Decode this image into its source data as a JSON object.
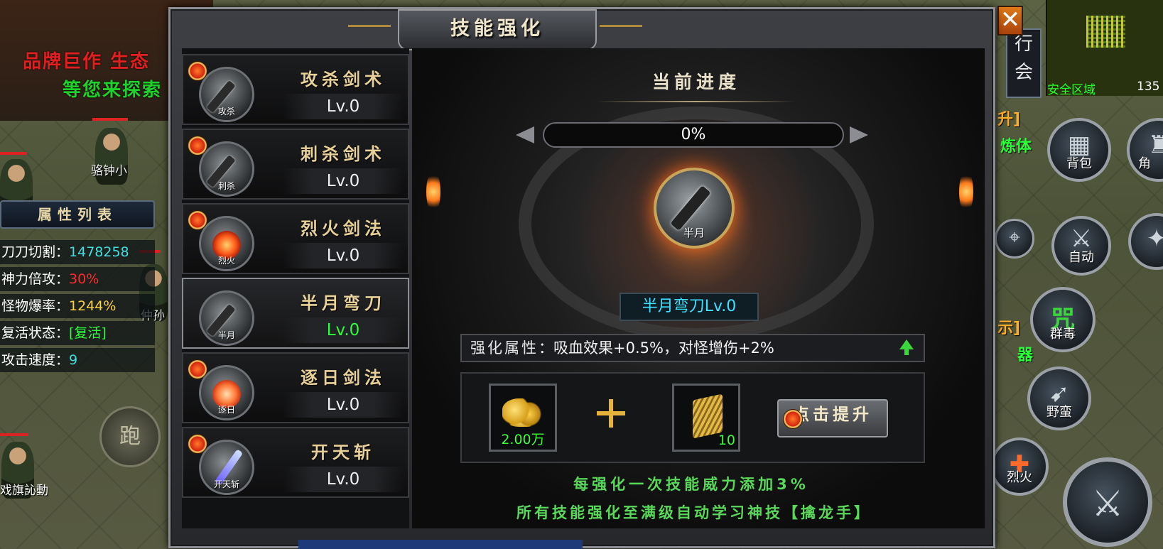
{
  "background": {
    "promo_line1": "品牌巨作  生态",
    "promo_line2": "等您来探索",
    "npc_names": [
      "骆钟小",
      "仲孙",
      "戏旗訫動"
    ],
    "run_button": "跑",
    "attributes": {
      "title": "属性列表",
      "rows": [
        {
          "label": "刀刀切割：",
          "value": "1478258",
          "color": "cyan"
        },
        {
          "label": "神力倍攻：",
          "value": "30%",
          "color": "red"
        },
        {
          "label": "怪物爆率：",
          "value": "1244%",
          "color": "yellow"
        },
        {
          "label": "复活状态：",
          "value": "[复活]",
          "color": "green"
        },
        {
          "label": "攻击速度：",
          "value": "9",
          "color": "cyan"
        }
      ]
    },
    "minimap": {
      "zone": "安全区域",
      "coord": "135"
    },
    "guild_button": [
      "行",
      "会"
    ],
    "side_labels": [
      "升]",
      "炼体",
      "示]",
      "器"
    ],
    "hud_buttons": [
      {
        "label": "背包",
        "icon": "bag-icon"
      },
      {
        "label": "角",
        "icon": "armor-icon"
      },
      {
        "label": "自动",
        "icon": "crossed-swords-icon"
      },
      {
        "label": "群毒",
        "glyph": "咒"
      },
      {
        "label": "野蛮",
        "icon": "charge-icon"
      },
      {
        "label": "烈火",
        "icon": "fire-sword-icon"
      }
    ]
  },
  "panel": {
    "title": "技能强化",
    "close_label": "✕",
    "skills": [
      {
        "name": "攻杀剑术",
        "level": "Lv.0",
        "icon_label": "攻杀",
        "icon_type": "blade"
      },
      {
        "name": "刺杀剑术",
        "level": "Lv.0",
        "icon_label": "刺杀",
        "icon_type": "blade"
      },
      {
        "name": "烈火剑法",
        "level": "Lv.0",
        "icon_label": "烈火",
        "icon_type": "fire"
      },
      {
        "name": "半月弯刀",
        "level": "Lv.0",
        "icon_label": "半月",
        "icon_type": "blade",
        "selected": true
      },
      {
        "name": "逐日剑法",
        "level": "Lv.0",
        "icon_label": "逐日",
        "icon_type": "fire"
      },
      {
        "name": "开天斩",
        "level": "Lv.0",
        "icon_label": "开天斩",
        "icon_type": "beam"
      }
    ],
    "progress": {
      "title": "当前进度",
      "percent_text": "0%",
      "value": 0
    },
    "selected_skill": {
      "icon_label": "半月",
      "title": "半月弯刀Lv.0"
    },
    "enhance": {
      "label": "强化属性",
      "value": "：吸血效果+0.5%，对怪增伤+2%"
    },
    "costs": [
      {
        "item": "gold-coins",
        "qty": "2.00万"
      },
      {
        "item": "skill-scroll",
        "qty": "10"
      }
    ],
    "upgrade_button": "点击提升",
    "tips": [
      "每强化一次技能威力添加3%",
      "所有技能强化至满级自动学习神技【擒龙手】"
    ]
  }
}
